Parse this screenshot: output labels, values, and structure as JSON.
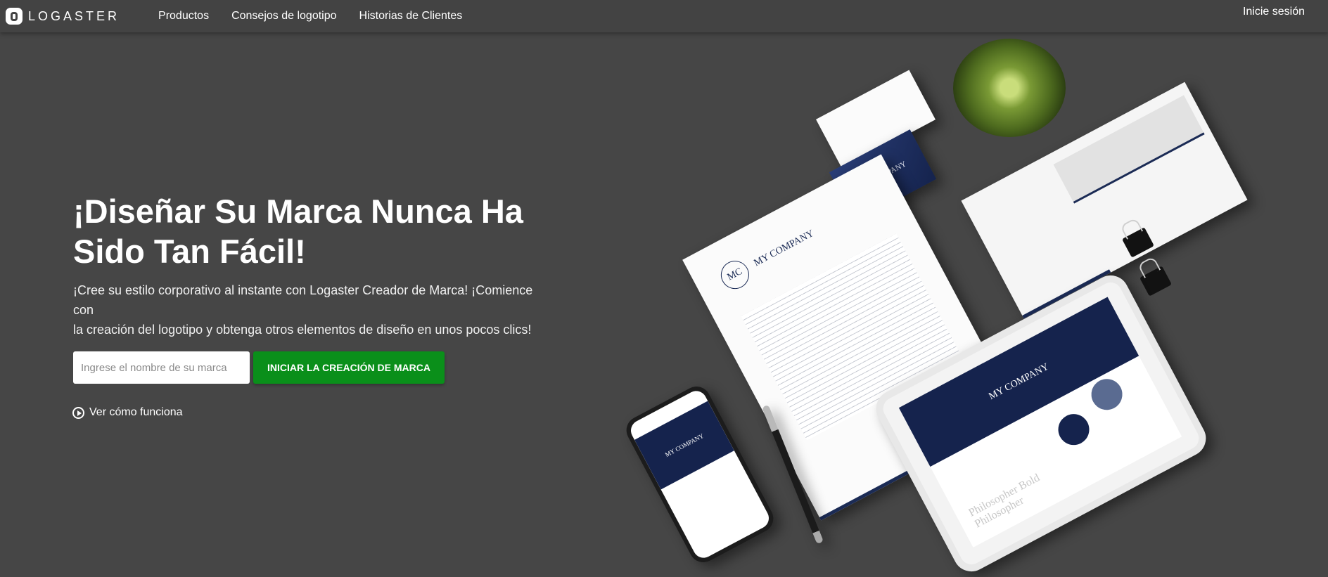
{
  "header": {
    "logo_text": "LOGASTER",
    "nav": [
      {
        "label": "Productos"
      },
      {
        "label": "Consejos de logotipo"
      },
      {
        "label": "Historias de Clientes"
      }
    ],
    "login_label": "Inicie sesión"
  },
  "hero": {
    "title_line1": "¡Diseñar Su Marca Nunca Ha",
    "title_line2": "Sido Tan Fácil!",
    "subtitle_line1": "¡Cree su estilo corporativo al instante con Logaster Creador de Marca! ¡Comience con",
    "subtitle_line2": "la creación del logotipo y obtenga otros elementos de diseño en unos pocos clics!",
    "input_placeholder": "Ingrese el nombre de su marca",
    "cta_label": "INICIAR LA CREACIÓN DE MARCA",
    "how_it_works": "Ver cómo funciona"
  },
  "mockup": {
    "monogram": "MC",
    "company_name": "MY COMPANY",
    "font_sample_1": "Philosopher Bold",
    "font_sample_2": "Philosopher"
  },
  "colors": {
    "background": "#464646",
    "header": "#434343",
    "cta": "#0a8f1a",
    "brand_navy": "#15234d"
  }
}
